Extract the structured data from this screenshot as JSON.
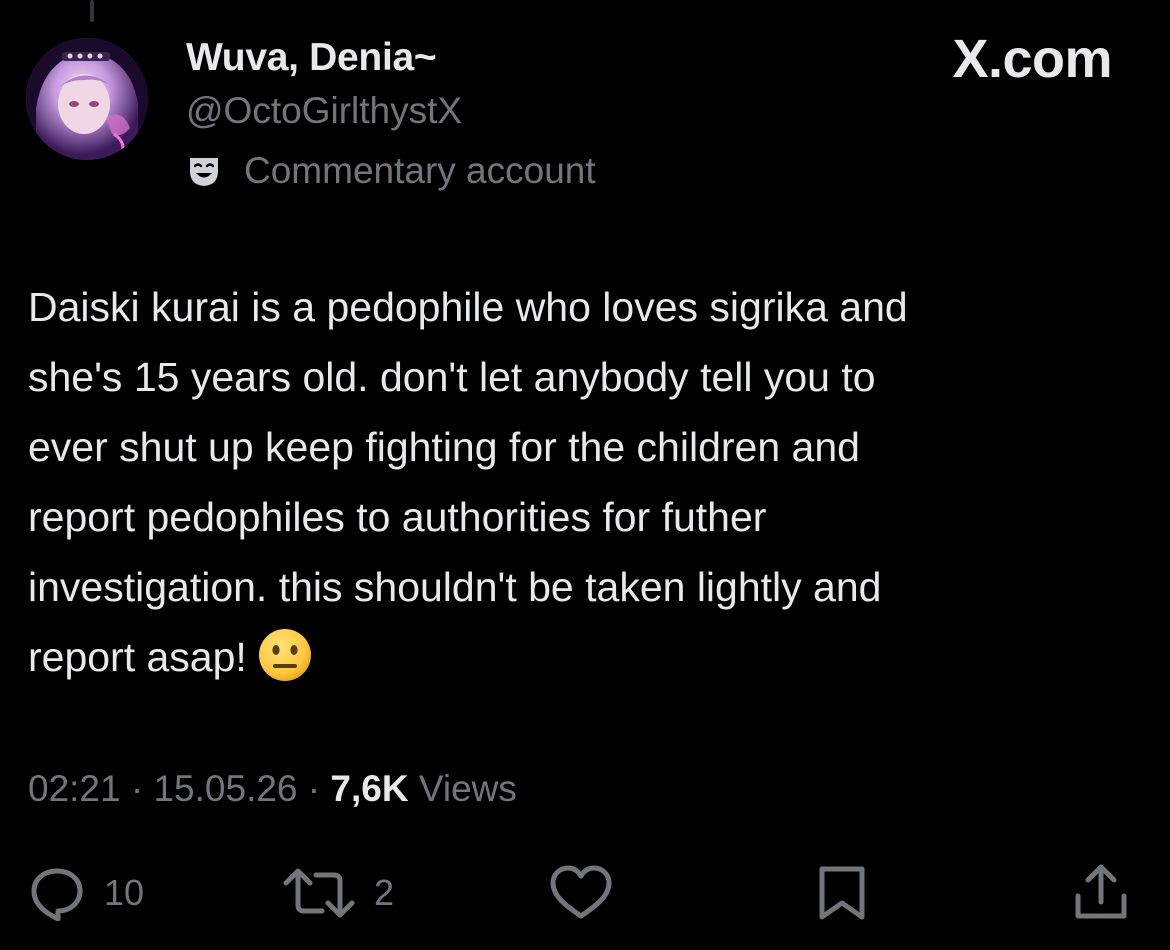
{
  "post": {
    "author": {
      "display_name": "Wuva, Denia~",
      "handle": "@OctoGirlthystX",
      "label": "Commentary account",
      "label_icon": "theater-mask-icon"
    },
    "watermark": "X.com",
    "text_lines": [
      "Daiski kurai is a pedophile who loves sigrika and",
      "she's 15 years old. don't let anybody tell you to",
      "ever shut up keep fighting for the children and",
      "report pedophiles to authorities for futher",
      "investigation. this shouldn't be taken lightly and",
      "report asap!"
    ],
    "emoji": "neutral-face-emoji",
    "meta": {
      "time": "02:21",
      "separator": " · ",
      "date": "15.05.26",
      "views_count": "7,6K",
      "views_label": "Views"
    },
    "actions": {
      "reply_count": "10",
      "repost_count": "2"
    }
  },
  "colors": {
    "background": "#000000",
    "primary_text": "#e7e9ea",
    "secondary_text": "#71767b",
    "emoji_yellow": "#ffc83d"
  }
}
